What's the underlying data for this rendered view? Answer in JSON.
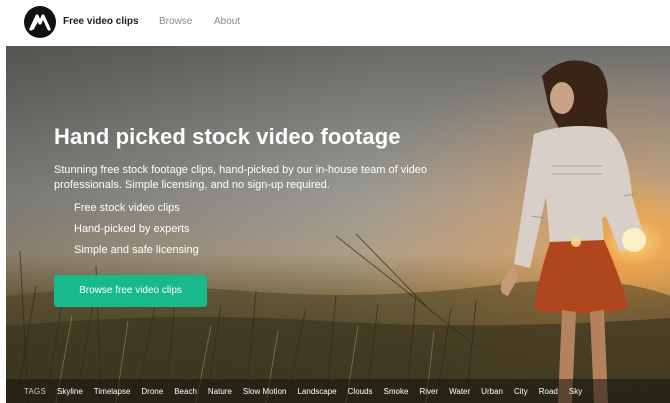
{
  "header": {
    "brand": "Free video clips",
    "nav": [
      {
        "label": "Browse"
      },
      {
        "label": "About"
      }
    ]
  },
  "hero": {
    "title": "Hand picked stock video footage",
    "description": "Stunning free stock footage clips, hand-picked by our in-house team of video professionals. Simple licensing, and no sign-up required.",
    "features": [
      "Free stock video clips",
      "Hand-picked by experts",
      "Simple and safe licensing"
    ],
    "cta_label": "Browse free video clips"
  },
  "tags": {
    "label": "TAGS",
    "items": [
      "Skyline",
      "Timelapse",
      "Drone",
      "Beach",
      "Nature",
      "Slow Motion",
      "Landscape",
      "Clouds",
      "Smoke",
      "River",
      "Water",
      "Urban",
      "City",
      "Road",
      "Sky"
    ]
  },
  "colors": {
    "accent": "#18b98a",
    "brand_dark": "#111111"
  },
  "icons": {
    "logo": "mountain-logo-icon"
  }
}
